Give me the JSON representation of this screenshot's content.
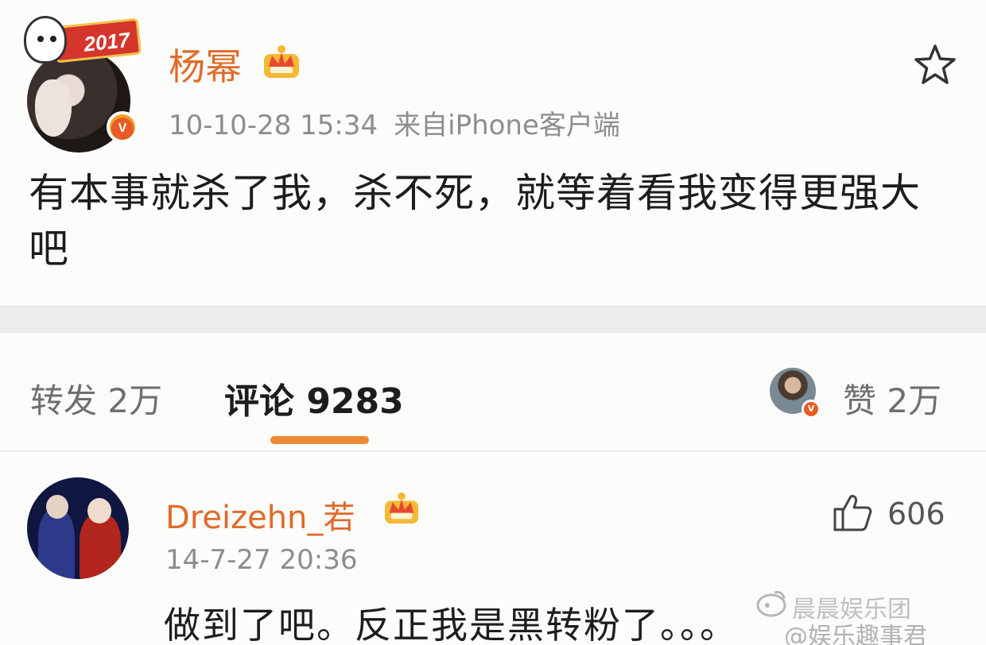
{
  "post": {
    "author_name": "杨幂",
    "avatar_badge_year": "2017",
    "verified_badge": "V",
    "timestamp": "10-10-28 15:34",
    "source": "来自iPhone客户端",
    "text": "有本事就杀了我，杀不死，就等着看我变得更强大吧"
  },
  "tabs": {
    "repost_label": "转发 2万",
    "comment_label": "评论 9283",
    "like_label": "赞 2万"
  },
  "comment": {
    "author_name": "Dreizehn_若",
    "timestamp": "14-7-27 20:36",
    "like_count": "606",
    "text": "做到了吧。反正我是黑转粉了。。。"
  },
  "watermark": {
    "line1": "晨晨娱乐团",
    "line2": "@娱乐趣事君"
  },
  "colors": {
    "name_orange": "#e06a28",
    "tab_underline": "#ee8a33",
    "meta_gray": "#8d8d8d"
  }
}
